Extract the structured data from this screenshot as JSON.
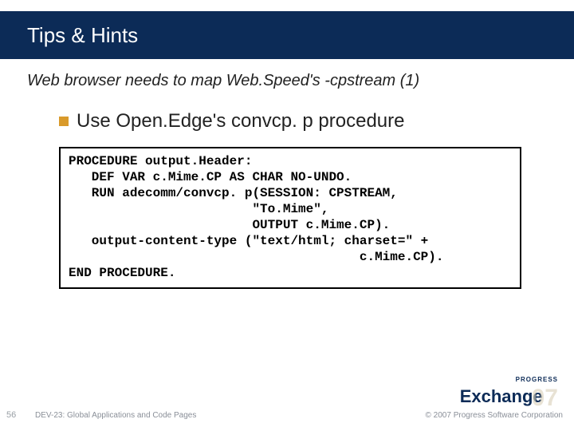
{
  "title": "Tips & Hints",
  "subtitle": "Web browser needs to map Web.Speed's -cpstream (1)",
  "bullet": "Use Open.Edge's convcp. p procedure",
  "code": "PROCEDURE output.Header:\n   DEF VAR c.Mime.CP AS CHAR NO-UNDO.\n   RUN adecomm/convcp. p(SESSION: CPSTREAM,\n                        \"To.Mime\",\n                        OUTPUT c.Mime.CP).\n   output-content-type (\"text/html; charset=\" +\n                                      c.Mime.CP).\nEND PROCEDURE.",
  "footer": {
    "slide_number": "56",
    "left": "DEV-23: Global Applications and Code Pages",
    "right": "© 2007 Progress Software Corporation"
  },
  "logo": {
    "top": "PROGRESS",
    "main": "Exchange",
    "year": "07"
  }
}
